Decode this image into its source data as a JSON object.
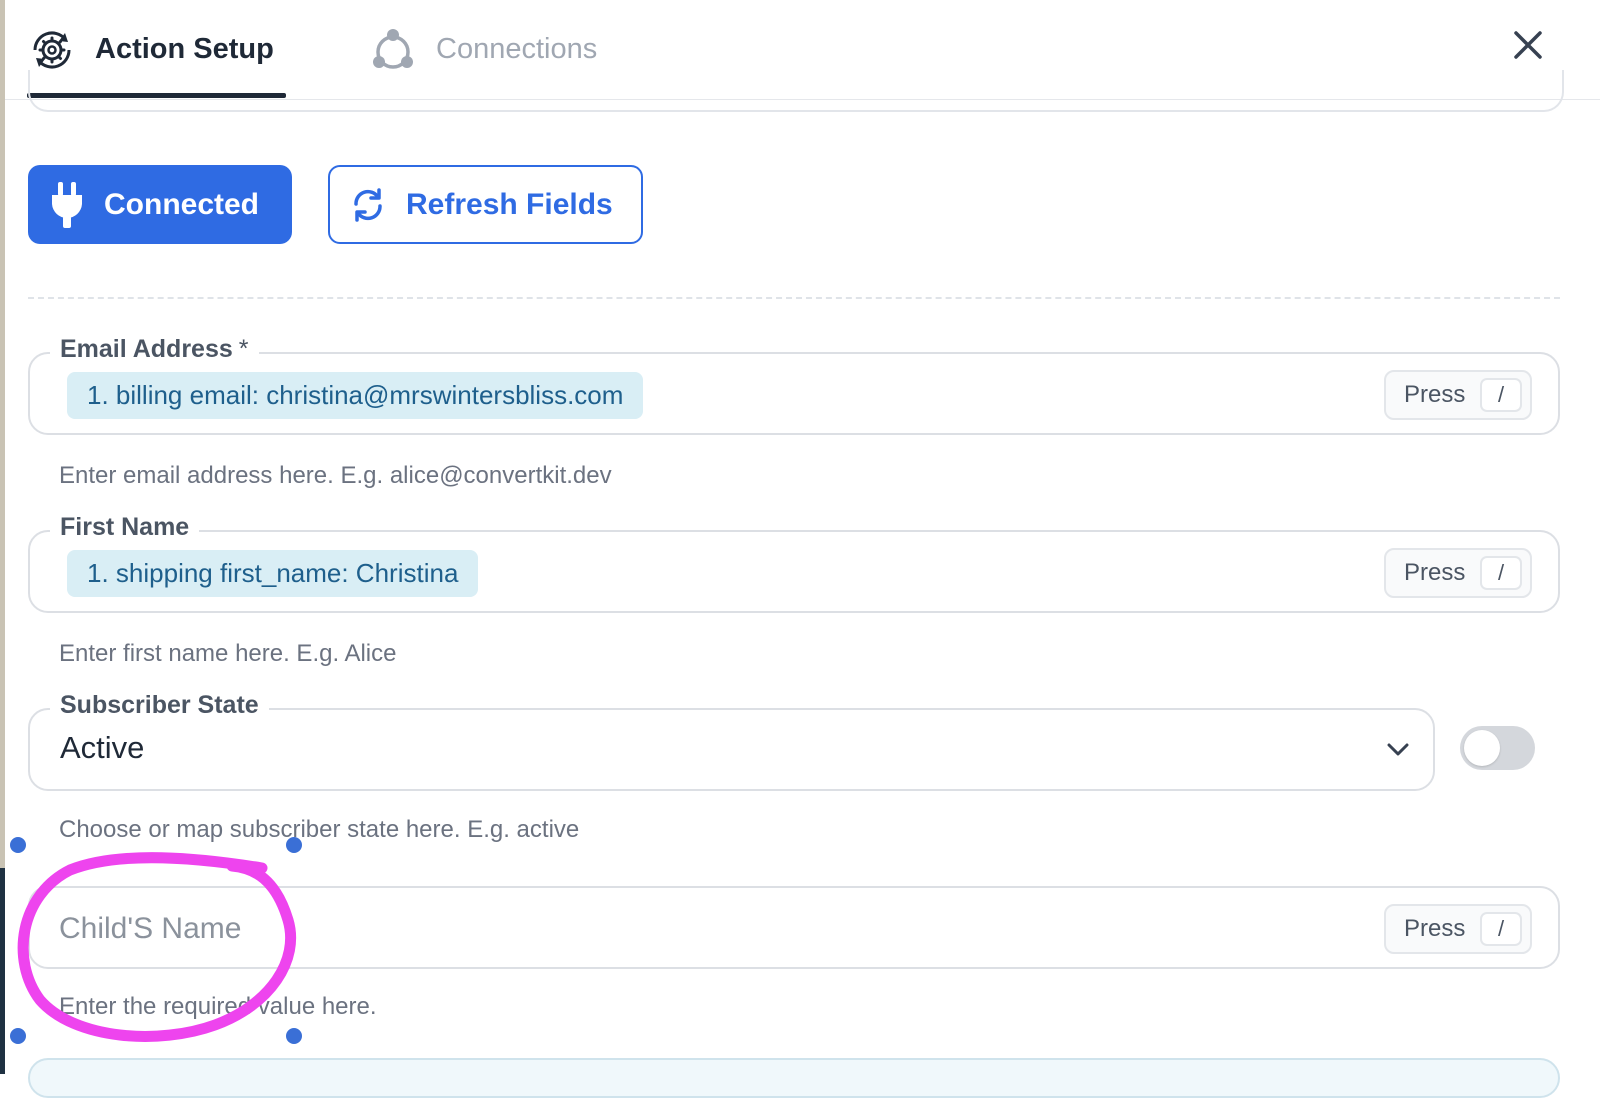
{
  "header": {
    "tabs": [
      {
        "label": "Action Setup",
        "icon": "gear-cycle-icon",
        "active": true
      },
      {
        "label": "Connections",
        "icon": "connections-icon",
        "active": false
      }
    ],
    "close_icon": "close-icon"
  },
  "actions": {
    "connected_label": "Connected",
    "refresh_label": "Refresh Fields"
  },
  "fields": {
    "email": {
      "label": "Email Address",
      "required_mark": "*",
      "chip": "1. billing email: christina@mrswintersbliss.com",
      "help": "Enter email address here. E.g. alice@convertkit.dev"
    },
    "first_name": {
      "label": "First Name",
      "chip": "1. shipping first_name: Christina",
      "help": "Enter first name here. E.g. Alice"
    },
    "subscriber_state": {
      "label": "Subscriber State",
      "value": "Active",
      "help": "Choose or map subscriber state here. E.g. active"
    },
    "child_name": {
      "placeholder": "Child'S Name",
      "help": "Enter the required value here."
    }
  },
  "press_hint": {
    "label": "Press",
    "key": "/"
  },
  "colors": {
    "primary": "#2f6be3",
    "chip_bg": "#d9eef5",
    "chip_text": "#1e5f8c",
    "annotation": "#ee44ee",
    "handle": "#3a6fd6"
  }
}
